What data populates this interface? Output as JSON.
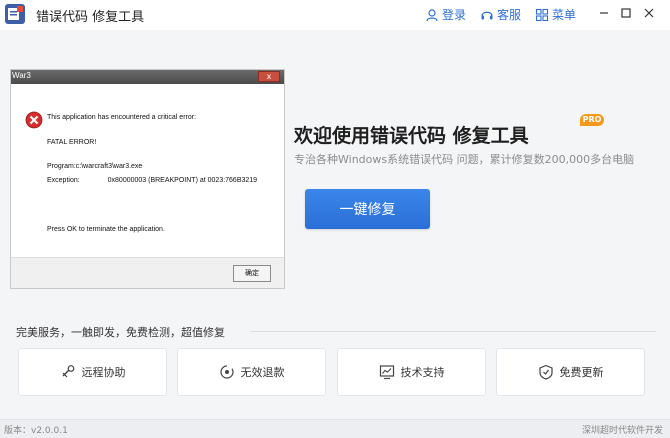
{
  "app": {
    "title": "错误代码 修复工具"
  },
  "header": {
    "login_label": "登录",
    "service_label": "客服",
    "menu_label": "菜单",
    "window_controls": [
      "minimize",
      "maximize",
      "close"
    ]
  },
  "error_dialog": {
    "title": "War3",
    "close_glyph": "x",
    "message": "This application has encountered a critical error:",
    "fatal": "FATAL ERROR!",
    "program": "Program:\tc:\\warcraft3\\war3.exe",
    "program_label": "Program:",
    "program_value": "c:\\warcraft3\\war3.exe",
    "exception_label": "Exception:",
    "exception_value": "0x80000003 (BREAKPOINT) at 0023:766B3219",
    "press_ok": "Press OK to terminate the application.",
    "ok_label": "确定"
  },
  "main": {
    "headline": "欢迎使用错误代码 修复工具",
    "badge": "PRO",
    "subline": "专治各种Windows系统错误代码 问题，累计修复数200,000多台电脑",
    "fix_button": "一键修复"
  },
  "services": {
    "label": "完美服务，一触即发，免费检测，超值修复",
    "items": [
      {
        "label": "远程协助",
        "icon": "remote-tools-icon"
      },
      {
        "label": "无效退款",
        "icon": "refund-icon"
      },
      {
        "label": "技术支持",
        "icon": "chart-monitor-icon"
      },
      {
        "label": "免费更新",
        "icon": "update-shield-icon"
      }
    ]
  },
  "footer": {
    "version": "版本：v2.0.0.1",
    "developer": "深圳超时代软件开发"
  },
  "colors": {
    "accent": "#2d6fd6",
    "badge": "#f39a1e",
    "error_red": "#d32f2f"
  }
}
